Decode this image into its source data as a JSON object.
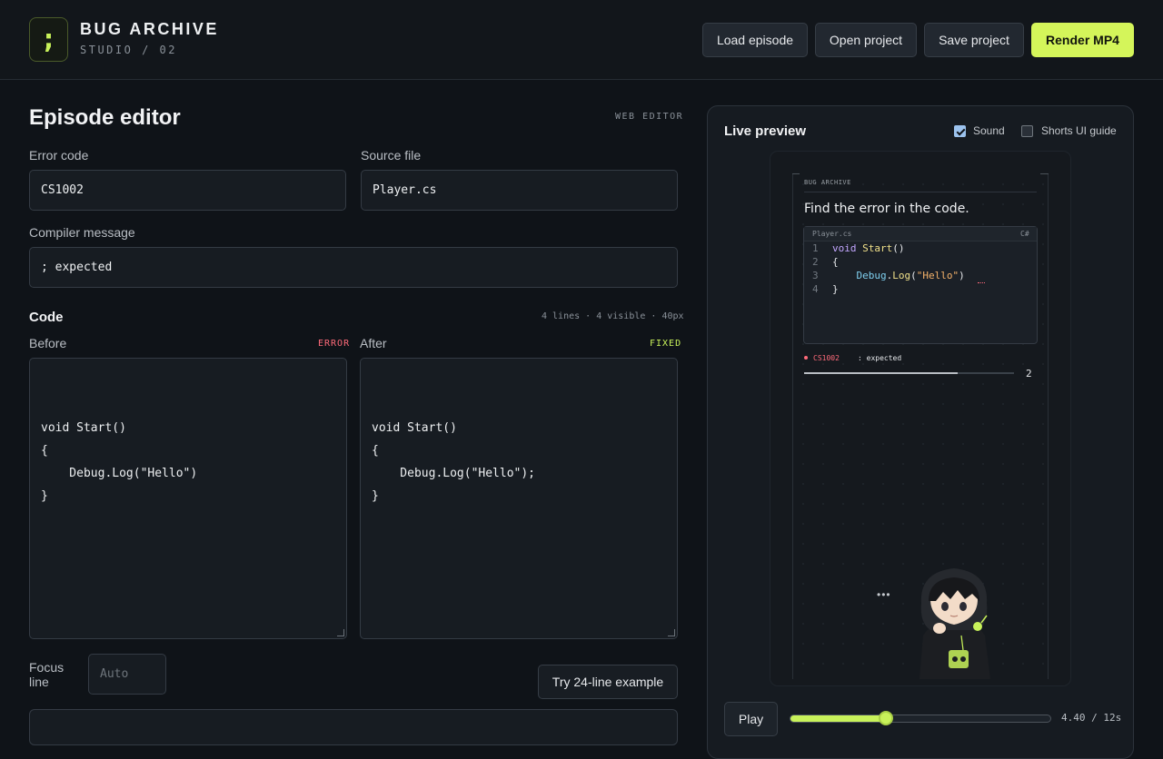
{
  "header": {
    "logo_glyph": ";",
    "brand_title": "BUG ARCHIVE",
    "brand_sub": "STUDIO / 02",
    "buttons": {
      "load": "Load episode",
      "open": "Open project",
      "save": "Save project",
      "render": "Render MP4"
    },
    "accent_color": "#d4f55a"
  },
  "editor": {
    "title": "Episode editor",
    "tag": "WEB EDITOR",
    "error_code_label": "Error code",
    "error_code_value": "CS1002",
    "source_file_label": "Source file",
    "source_file_value": "Player.cs",
    "compiler_message_label": "Compiler message",
    "compiler_message_value": "; expected",
    "code_section_title": "Code",
    "code_stats": "4 lines · 4 visible · 40px",
    "before_label": "Before",
    "before_tag": "ERROR",
    "after_label": "After",
    "after_tag": "FIXED",
    "before_code": "void Start()\n{\n    Debug.Log(\"Hello\")\n}",
    "after_code": "void Start()\n{\n    Debug.Log(\"Hello\");\n}",
    "focus_line_label_1": "Focus",
    "focus_line_label_2": "line",
    "focus_line_placeholder": "Auto",
    "try_example_button": "Try 24-line example",
    "status_colors": {
      "error": "#ff6b7a",
      "fixed": "#c8f25a"
    }
  },
  "preview": {
    "title": "Live preview",
    "sound_label": "Sound",
    "sound_checked": true,
    "shorts_guide_label": "Shorts UI guide",
    "shorts_guide_checked": false,
    "phone": {
      "brand": "BUG ARCHIVE",
      "question": "Find the error in the code.",
      "file_name": "Player.cs",
      "file_lang": "C#",
      "line_numbers": [
        "1",
        "2",
        "3",
        "4"
      ],
      "code_lines": [
        [
          {
            "t": "void",
            "c": "kw"
          },
          {
            "t": " "
          },
          {
            "t": "Start",
            "c": "fn"
          },
          {
            "t": "()"
          }
        ],
        [
          {
            "t": "{"
          }
        ],
        [
          {
            "t": "    "
          },
          {
            "t": "Debug",
            "c": "cls"
          },
          {
            "t": "."
          },
          {
            "t": "Log",
            "c": "fn"
          },
          {
            "t": "("
          },
          {
            "t": "\"Hello\"",
            "c": "str"
          },
          {
            "t": ")"
          }
        ],
        [
          {
            "t": "}"
          }
        ]
      ],
      "error_code": "CS1002",
      "error_message": ": expected",
      "progress_fraction": 0.73,
      "count": "2",
      "typing_indicator": "•••",
      "character": "hooded-coder-mascot"
    },
    "play_button": "Play",
    "playback_position_s": 4.4,
    "playback_duration_s": 12,
    "time_readout": "4.40 / 12s"
  }
}
